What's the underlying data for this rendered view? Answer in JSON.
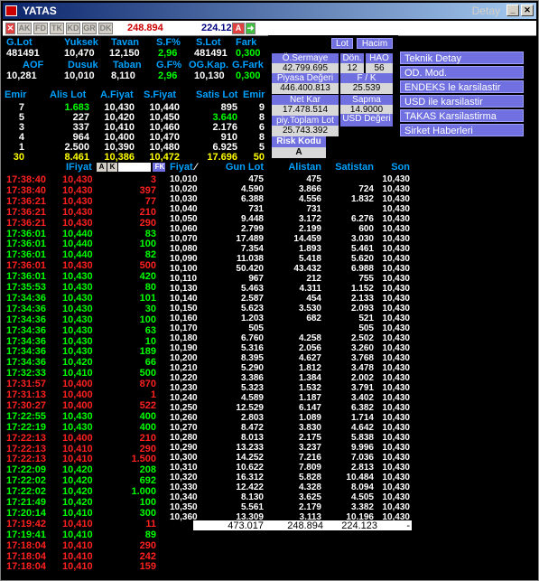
{
  "window": {
    "title": "YATAS",
    "detail": "Detay"
  },
  "toolbar": {
    "tabs": [
      "AK",
      "FD",
      "TK",
      "KD",
      "GR",
      "DK"
    ],
    "alis_lot_total": "248.894",
    "satis_lot_total": "224.123",
    "a_btn": "A"
  },
  "stats": {
    "row1_headers": [
      "G.Lot",
      "Yuksek",
      "Tavan",
      "S.F%",
      "S.Lot",
      "Fark"
    ],
    "row1_values": [
      "481491",
      "10,470",
      "12,150",
      "2,96",
      "481491",
      "0,300"
    ],
    "row2_headers": [
      "AOF",
      "Dusuk",
      "Taban",
      "G.F%",
      "OG.Kap.",
      "G.Fark"
    ],
    "row2_values": [
      "10,281",
      "10,010",
      "8,110",
      "2,96",
      "10,130",
      "0,300"
    ]
  },
  "info": {
    "lot_btn": "Lot",
    "hacim_btn": "Hacim",
    "o_sermaye_label": "Ö.Sermaye",
    "o_sermaye_value": "42.799.695",
    "don_label": "Dön.",
    "don_value": "12",
    "hao_label": "HAO",
    "hao_value": "56",
    "piyasa_label": "Piyasa Değeri",
    "piyasa_value": "446.400.813",
    "fk_label": "F / K",
    "fk_value": "25.539",
    "netkar_label": "Net Kar",
    "netkar_value": "17.478.514",
    "sapma_label": "Sapma",
    "sapma_value": "14.9000",
    "piytoplam_label": "piy.Toplam Lot",
    "piytoplam_value": "25.743.392",
    "usd_label": "USD Değeri",
    "risk_label": "Risk Kodu",
    "risk_value": "A"
  },
  "links": [
    "Teknik Detay",
    "OD. Mod.",
    "ENDEKS le karsilastir",
    "USD ile karsilastir",
    "TAKAS Karsilastirma",
    "Sirket Haberleri"
  ],
  "depth": {
    "headers": [
      "Emir",
      "Alis Lot",
      "A.Fiyat",
      "S.Fiyat",
      "Satis Lot",
      "Emir"
    ],
    "rows": [
      [
        "7",
        "1.683",
        "10,430",
        "10,440",
        "895",
        "9"
      ],
      [
        "5",
        "227",
        "10,420",
        "10,450",
        "3.640",
        "8"
      ],
      [
        "3",
        "337",
        "10,410",
        "10,460",
        "2.176",
        "6"
      ],
      [
        "4",
        "964",
        "10,400",
        "10,470",
        "910",
        "8"
      ],
      [
        "1",
        "2.500",
        "10,390",
        "10,480",
        "6.925",
        "5"
      ]
    ],
    "total": [
      "30",
      "8.461",
      "10,386",
      "10,472",
      "17.696",
      "50"
    ]
  },
  "trades": {
    "header_label": "IFiyat",
    "a_btn": "A",
    "k_btn": "K",
    "fk_btn": "FK",
    "rows": [
      [
        "17:38:40",
        "10,430",
        "3",
        "r"
      ],
      [
        "17:38:40",
        "10,430",
        "397",
        "r"
      ],
      [
        "17:36:21",
        "10,430",
        "77",
        "r"
      ],
      [
        "17:36:21",
        "10,430",
        "210",
        "r"
      ],
      [
        "17:36:21",
        "10,430",
        "290",
        "r"
      ],
      [
        "17:36:01",
        "10,440",
        "83",
        "g"
      ],
      [
        "17:36:01",
        "10,440",
        "100",
        "g"
      ],
      [
        "17:36:01",
        "10,440",
        "82",
        "g"
      ],
      [
        "17:36:01",
        "10,430",
        "500",
        "r"
      ],
      [
        "17:36:01",
        "10,430",
        "420",
        "g"
      ],
      [
        "17:35:53",
        "10,430",
        "80",
        "g"
      ],
      [
        "17:34:36",
        "10,430",
        "101",
        "g"
      ],
      [
        "17:34:36",
        "10,430",
        "30",
        "g"
      ],
      [
        "17:34:36",
        "10,430",
        "100",
        "g"
      ],
      [
        "17:34:36",
        "10,430",
        "63",
        "g"
      ],
      [
        "17:34:36",
        "10,430",
        "10",
        "g"
      ],
      [
        "17:34:36",
        "10,430",
        "189",
        "g"
      ],
      [
        "17:34:36",
        "10,420",
        "66",
        "g"
      ],
      [
        "17:32:33",
        "10,410",
        "500",
        "g"
      ],
      [
        "17:31:57",
        "10,400",
        "870",
        "r"
      ],
      [
        "17:31:13",
        "10,400",
        "1",
        "r"
      ],
      [
        "17:30:27",
        "10,400",
        "522",
        "r"
      ],
      [
        "17:22:55",
        "10,430",
        "400",
        "g"
      ],
      [
        "17:22:19",
        "10,430",
        "400",
        "g"
      ],
      [
        "17:22:13",
        "10,400",
        "210",
        "r"
      ],
      [
        "17:22:13",
        "10,410",
        "290",
        "r"
      ],
      [
        "17:22:13",
        "10,410",
        "1.500",
        "r"
      ],
      [
        "17:22:09",
        "10,420",
        "208",
        "g"
      ],
      [
        "17:22:02",
        "10,420",
        "692",
        "g"
      ],
      [
        "17:22:02",
        "10,420",
        "1.000",
        "g"
      ],
      [
        "17:21:49",
        "10,420",
        "100",
        "g"
      ],
      [
        "17:20:14",
        "10,410",
        "300",
        "g"
      ],
      [
        "17:19:42",
        "10,410",
        "11",
        "r"
      ],
      [
        "17:19:41",
        "10,410",
        "89",
        "g"
      ],
      [
        "17:18:04",
        "10,410",
        "290",
        "r"
      ],
      [
        "17:18:04",
        "10,410",
        "242",
        "r"
      ],
      [
        "17:18:04",
        "10,410",
        "159",
        "r"
      ]
    ]
  },
  "price_table": {
    "headers": [
      "Fiyat",
      "Gun Lot",
      "Alistan",
      "Satistan",
      "Son"
    ],
    "rows": [
      [
        "10,010",
        "475",
        "475",
        "",
        "10,430"
      ],
      [
        "10,020",
        "4.590",
        "3.866",
        "724",
        "10,430"
      ],
      [
        "10,030",
        "6.388",
        "4.556",
        "1.832",
        "10,430"
      ],
      [
        "10,040",
        "731",
        "731",
        "",
        "10,430"
      ],
      [
        "10,050",
        "9.448",
        "3.172",
        "6.276",
        "10,430"
      ],
      [
        "10,060",
        "2.799",
        "2.199",
        "600",
        "10,430"
      ],
      [
        "10,070",
        "17.489",
        "14.459",
        "3.030",
        "10,430"
      ],
      [
        "10,080",
        "7.354",
        "1.893",
        "5.461",
        "10,430"
      ],
      [
        "10,090",
        "11.038",
        "5.418",
        "5.620",
        "10,430"
      ],
      [
        "10,100",
        "50.420",
        "43.432",
        "6.988",
        "10,430"
      ],
      [
        "10,110",
        "967",
        "212",
        "755",
        "10,430"
      ],
      [
        "10,130",
        "5.463",
        "4.311",
        "1.152",
        "10,430"
      ],
      [
        "10,140",
        "2.587",
        "454",
        "2.133",
        "10,430"
      ],
      [
        "10,150",
        "5.623",
        "3.530",
        "2.093",
        "10,430"
      ],
      [
        "10,160",
        "1.203",
        "682",
        "521",
        "10,430"
      ],
      [
        "10,170",
        "505",
        "",
        "505",
        "10,430"
      ],
      [
        "10,180",
        "6.760",
        "4.258",
        "2.502",
        "10,430"
      ],
      [
        "10,190",
        "5.316",
        "2.056",
        "3.260",
        "10,430"
      ],
      [
        "10,200",
        "8.395",
        "4.627",
        "3.768",
        "10,430"
      ],
      [
        "10,210",
        "5.290",
        "1.812",
        "3.478",
        "10,430"
      ],
      [
        "10,220",
        "3.386",
        "1.384",
        "2.002",
        "10,430"
      ],
      [
        "10,230",
        "5.323",
        "1.532",
        "3.791",
        "10,430"
      ],
      [
        "10,240",
        "4.589",
        "1.187",
        "3.402",
        "10,430"
      ],
      [
        "10,250",
        "12.529",
        "6.147",
        "6.382",
        "10,430"
      ],
      [
        "10,260",
        "2.803",
        "1.089",
        "1.714",
        "10,430"
      ],
      [
        "10,270",
        "8.472",
        "3.830",
        "4.642",
        "10,430"
      ],
      [
        "10,280",
        "8.013",
        "2.175",
        "5.838",
        "10,430"
      ],
      [
        "10,290",
        "13.233",
        "3.237",
        "9.996",
        "10,430"
      ],
      [
        "10,300",
        "14.252",
        "7.216",
        "7.036",
        "10,430"
      ],
      [
        "10,310",
        "10.622",
        "7.809",
        "2.813",
        "10,430"
      ],
      [
        "10,320",
        "16.312",
        "5.828",
        "10.484",
        "10,430"
      ],
      [
        "10,330",
        "12.422",
        "4.328",
        "8.094",
        "10,430"
      ],
      [
        "10,340",
        "8.130",
        "3.625",
        "4.505",
        "10,430"
      ],
      [
        "10,350",
        "5.561",
        "2.179",
        "3.382",
        "10,430"
      ],
      [
        "10,360",
        "13.309",
        "3.113",
        "10.196",
        "10,430"
      ]
    ],
    "totals": [
      "473.017",
      "248.894",
      "224.123",
      "-"
    ]
  }
}
